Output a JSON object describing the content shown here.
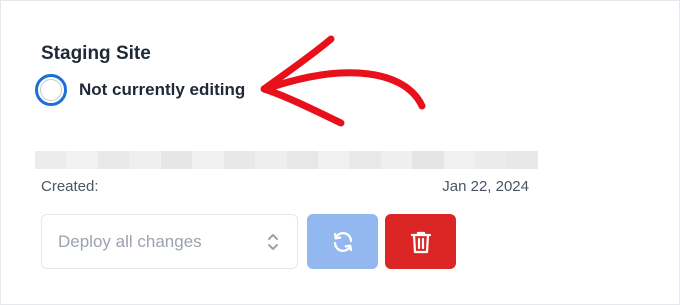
{
  "staging": {
    "title": "Staging Site",
    "status": "Not currently editing",
    "created_label": "Created:",
    "created_date": "Jan 22, 2024"
  },
  "deploy": {
    "selected": "Deploy all changes"
  },
  "buttons": {
    "refresh_icon": "refresh-icon",
    "delete_icon": "trash-icon"
  },
  "colors": {
    "radio": "#1d6fd8",
    "refresh_button": "#93b8ef",
    "delete_button": "#dc2626",
    "annotation_arrow": "#e8101a"
  }
}
